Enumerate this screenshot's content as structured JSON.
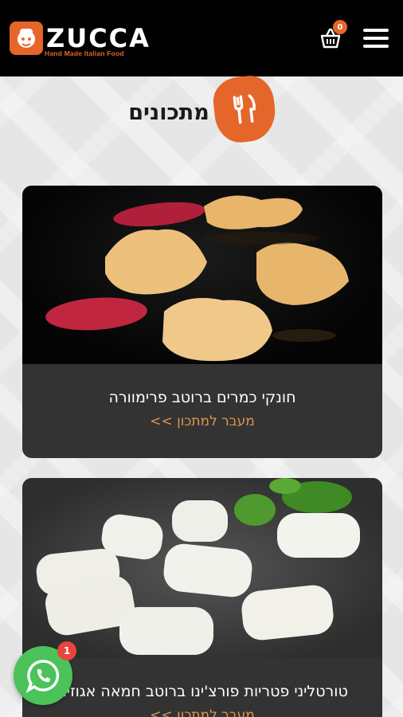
{
  "header": {
    "logo_text": "ZUCCA",
    "logo_tagline": "Hand Made Italian Food",
    "cart_count": "0"
  },
  "page": {
    "title": "מתכונים",
    "title_icon": "fork-knife-icon"
  },
  "recipes": [
    {
      "title": "חונקי כמרים ברוטב פרימוורה",
      "link_label": "מעבר למתכון >>",
      "image": "filled-pasta-with-beet-slices"
    },
    {
      "title": "טורטליני פטריות פורצ'ינו ברוטב חמאה אגוזים",
      "link_label": "מעבר למתכון >>",
      "image": "gnocchi-with-basil"
    }
  ],
  "whatsapp": {
    "badge_count": "1",
    "icon": "whatsapp-icon"
  },
  "colors": {
    "accent": "#e5662a",
    "header_bg": "#000000",
    "card_bg": "#333333",
    "link": "#e0944f",
    "whatsapp": "#4bc35a"
  }
}
